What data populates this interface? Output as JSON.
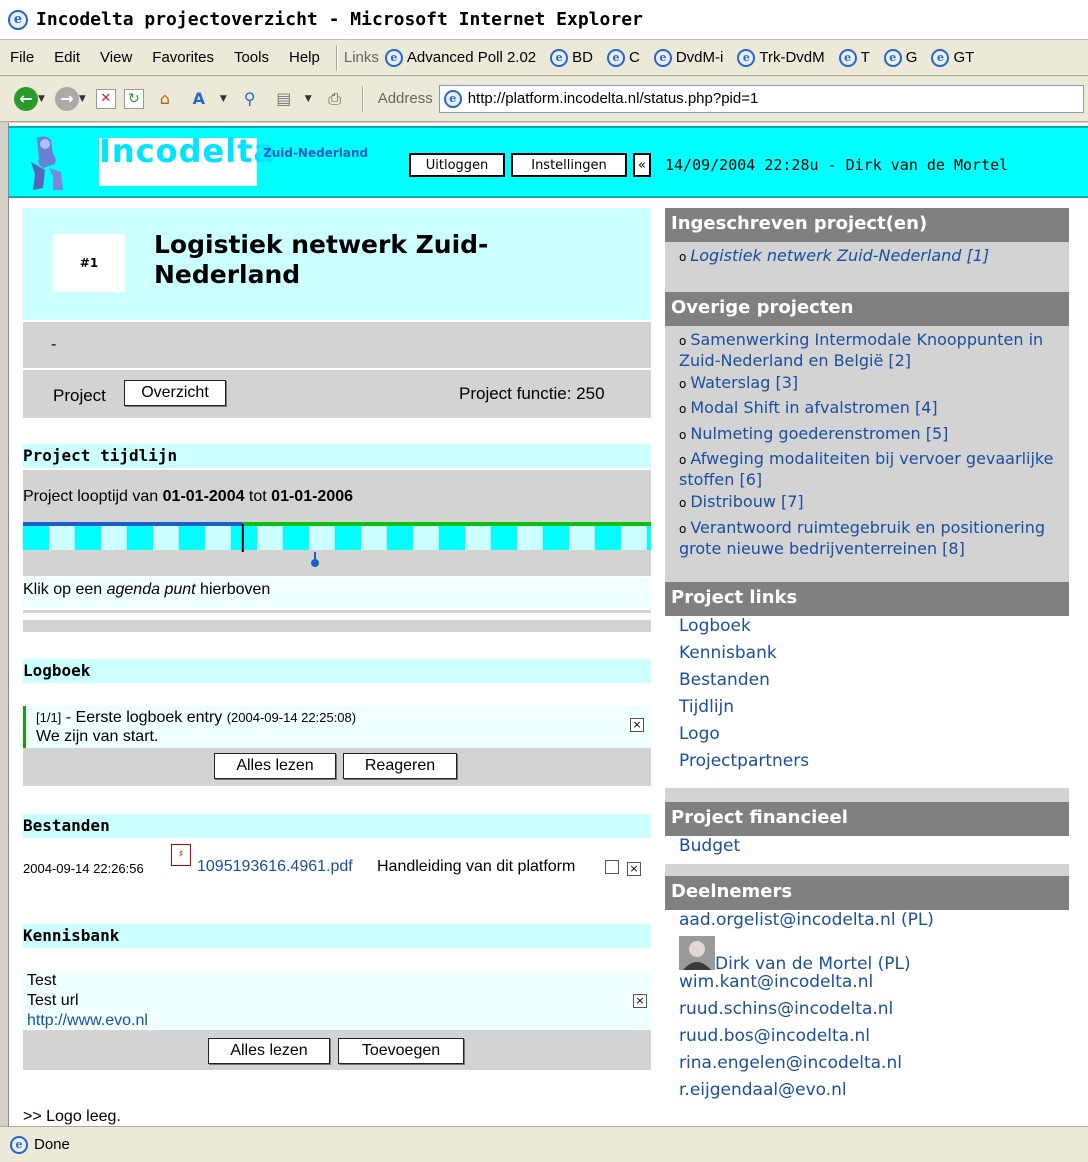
{
  "window": {
    "title": "Incodelta projectoverzicht - Microsoft Internet Explorer"
  },
  "menu": [
    "File",
    "Edit",
    "View",
    "Favorites",
    "Tools",
    "Help"
  ],
  "links_bar": {
    "label": "Links",
    "items": [
      "Advanced Poll 2.02",
      "BD",
      "C",
      "DvdM-i",
      "Trk-DvdM",
      "T",
      "G",
      "GT"
    ]
  },
  "address": {
    "label": "Address",
    "url": "http://platform.incodelta.nl/status.php?pid=1"
  },
  "header": {
    "logo": "Incodelta",
    "region": "Zuid-Nederland",
    "logout": "Uitloggen",
    "settings": "Instellingen",
    "collapse": "«",
    "datetime": "14/09/2004 22:28u - Dirk van de Mortel"
  },
  "project": {
    "number": "#1",
    "title": "Logistiek netwerk Zuid-Nederland",
    "description": "-",
    "project_label": "Project",
    "overview_button": "Overzicht",
    "function": "Project functie: 250"
  },
  "timeline": {
    "heading": "Project tijdlijn",
    "prefix": "Project looptijd van ",
    "start": "01-01-2004",
    "middle": " tot ",
    "end": "01-01-2006",
    "hint_a": "Klik op een ",
    "hint_em": "agenda punt",
    "hint_b": " hierboven",
    "elapsed_fraction": 0.35
  },
  "logbook": {
    "heading": "Logboek",
    "entry_index": "[1/1]",
    "entry_title": " - Eerste logboek entry ",
    "entry_date": "(2004-09-14 22:25:08)",
    "entry_text": "We zijn van start.",
    "read_all": "Alles lezen",
    "respond": "Reageren"
  },
  "files": {
    "heading": "Bestanden",
    "date": "2004-09-14 22:26:56",
    "filename": "1095193616.4961.pdf",
    "description": "Handleiding van dit platform"
  },
  "knowledge": {
    "heading": "Kennisbank",
    "title": "Test",
    "subtitle": "Test url",
    "url": "http://www.evo.nl",
    "read_all": "Alles lezen",
    "add": "Toevoegen"
  },
  "logo_status": ">> Logo leeg.",
  "sidebar": {
    "subscribed_heading": "Ingeschreven project(en)",
    "subscribed": "Logistiek netwerk Zuid-Nederland [1]",
    "other_heading": "Overige projecten",
    "other": [
      "Samenwerking Intermodale Knooppunten in Zuid-Nederland en België [2]",
      "Waterslag [3]",
      "Modal Shift in afvalstromen [4]",
      "Nulmeting goederenstromen [5]",
      "Afweging modaliteiten bij vervoer gevaarlijke stoffen [6]",
      "Distribouw [7]",
      "Verantwoord ruimtegebruik en positionering grote nieuwe bedrijventerreinen [8]"
    ],
    "links_heading": "Project links",
    "links": [
      "Logboek",
      "Kennisbank",
      "Bestanden",
      "Tijdlijn",
      "Logo",
      "Projectpartners"
    ],
    "finance_heading": "Project financieel",
    "finance": "Budget",
    "members_heading": "Deelnemers",
    "members": [
      "aad.orgelist@incodelta.nl (PL)",
      "Dirk van de Mortel (PL)",
      "wim.kant@incodelta.nl",
      "ruud.schins@incodelta.nl",
      "ruud.bos@incodelta.nl",
      "rina.engelen@incodelta.nl",
      "r.eijgendaal@evo.nl"
    ]
  },
  "status": "Done",
  "colors": {
    "cyan": "#00ffff",
    "light_cyan": "#ccffff",
    "gray": "#d3d3d3",
    "dark_gray": "#808080",
    "link": "#1a4fa0",
    "timeline_blue": "#1a5fc8",
    "timeline_green": "#10c010"
  }
}
